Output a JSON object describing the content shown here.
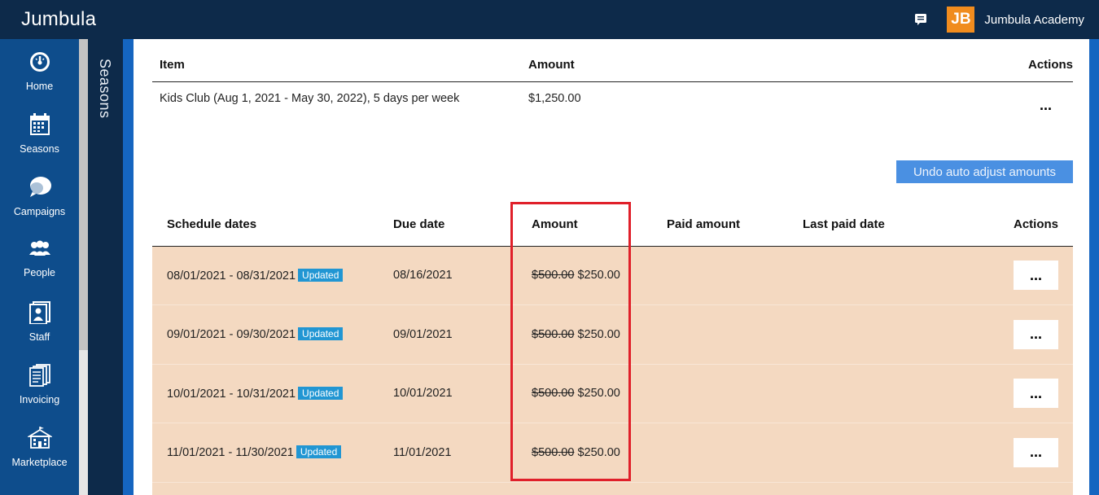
{
  "app": {
    "brand": "Jumbula"
  },
  "header": {
    "org_logo_text": "JB",
    "org_name": "Jumbula Academy",
    "message_icon": "chat-icon"
  },
  "nav": [
    {
      "label": "Home",
      "icon": "gauge-icon"
    },
    {
      "label": "Seasons",
      "icon": "calendar-icon"
    },
    {
      "label": "Campaigns",
      "icon": "chat-bubbles-icon"
    },
    {
      "label": "People",
      "icon": "people-icon"
    },
    {
      "label": "Staff",
      "icon": "staff-icon"
    },
    {
      "label": "Invoicing",
      "icon": "documents-icon"
    },
    {
      "label": "Marketplace",
      "icon": "building-icon"
    }
  ],
  "seasons_tab": {
    "label": "Seasons"
  },
  "items_table": {
    "headers": {
      "item": "Item",
      "amount": "Amount",
      "actions": "Actions"
    },
    "rows": [
      {
        "item": "Kids Club (Aug 1, 2021 - May 30, 2022), 5 days per week",
        "amount": "$1,250.00",
        "actions": "..."
      }
    ]
  },
  "undo_button": {
    "label": "Undo auto adjust amounts"
  },
  "schedule_table": {
    "headers": {
      "dates": "Schedule dates",
      "due": "Due date",
      "amount": "Amount",
      "paid": "Paid amount",
      "last_paid": "Last paid date",
      "actions": "Actions"
    },
    "rows": [
      {
        "dates": "08/01/2021 - 08/31/2021",
        "badge": "Updated",
        "due": "08/16/2021",
        "old_amount": "$500.00",
        "new_amount": "$250.00",
        "paid": "",
        "last_paid": "",
        "actions": "..."
      },
      {
        "dates": "09/01/2021 - 09/30/2021",
        "badge": "Updated",
        "due": "09/01/2021",
        "old_amount": "$500.00",
        "new_amount": "$250.00",
        "paid": "",
        "last_paid": "",
        "actions": "..."
      },
      {
        "dates": "10/01/2021 - 10/31/2021",
        "badge": "Updated",
        "due": "10/01/2021",
        "old_amount": "$500.00",
        "new_amount": "$250.00",
        "paid": "",
        "last_paid": "",
        "actions": "..."
      },
      {
        "dates": "11/01/2021 - 11/30/2021",
        "badge": "Updated",
        "due": "11/01/2021",
        "old_amount": "$500.00",
        "new_amount": "$250.00",
        "paid": "",
        "last_paid": "",
        "actions": "..."
      }
    ]
  },
  "colors": {
    "topbar": "#0d2a4a",
    "nav": "#0e4d8c",
    "row_bg": "#f4d9c1",
    "badge": "#2196d3",
    "highlight": "#e0202a",
    "undo_button": "#4a90e2"
  }
}
